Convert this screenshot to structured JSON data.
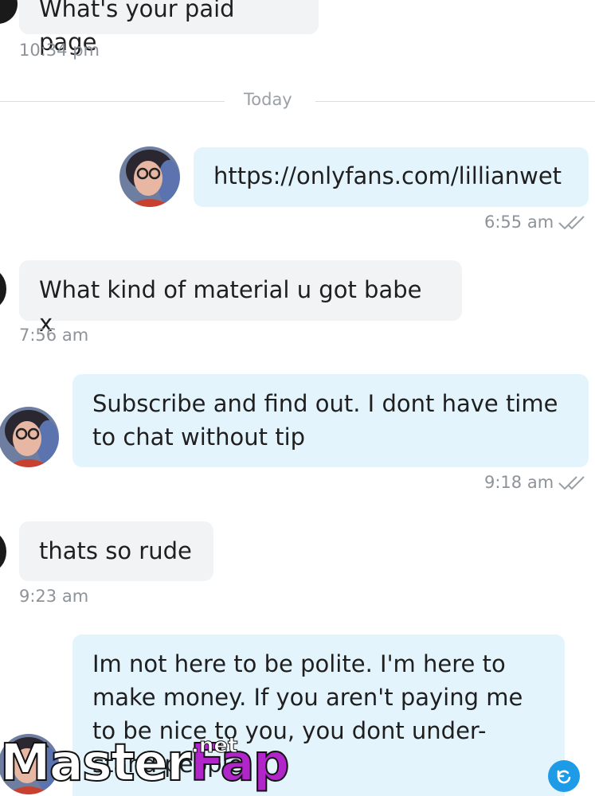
{
  "messages": [
    {
      "id": "m0",
      "direction": "incoming",
      "text": "What's your paid page",
      "time": "10:34 pm"
    },
    {
      "id": "m1",
      "direction": "outgoing",
      "text": "https://onlyfans.com/lillianwet",
      "time": "6:55 am",
      "status": "read-double-check-icon"
    },
    {
      "id": "m2",
      "direction": "incoming",
      "text": "What kind of material u got babe x",
      "time": "7:56 am"
    },
    {
      "id": "m3",
      "direction": "outgoing",
      "text": "Subscribe and find out. I dont have time to chat without tip",
      "time": "9:18 am",
      "status": "read-double-check-icon"
    },
    {
      "id": "m4",
      "direction": "incoming",
      "text": "thats so rude",
      "time": "9:23 am"
    },
    {
      "id": "m5",
      "direction": "outgoing",
      "text": "Im not here to be polite. I'm here to make money. If you aren't paying me to be nice to you, you dont under-stand people."
    }
  ],
  "divider": {
    "label": "Today"
  },
  "watermark": {
    "part1": "Master",
    "part2": "Fap",
    "suffix": ".net"
  },
  "colors": {
    "incoming_bubble": "#f1f3f4",
    "outgoing_bubble": "#e3f4fd",
    "timestamp": "#8d9398",
    "accent": "#1e9be6",
    "watermark_accent": "#b026c8"
  },
  "icons": {
    "read_status": "double-check-icon",
    "scroll": "scroll-to-bottom-icon"
  }
}
